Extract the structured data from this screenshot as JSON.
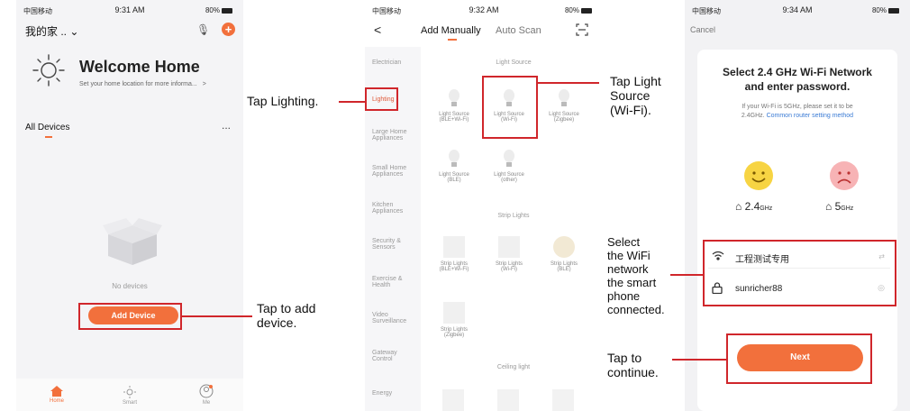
{
  "phone1": {
    "status": {
      "carrier": "中国移动",
      "time": "9:31 AM",
      "battery": "80%"
    },
    "home_name": "我的家",
    "welcome_title": "Welcome Home",
    "welcome_subtitle": "Set your home location for more informa...",
    "welcome_chevron": ">",
    "all_devices_label": "All Devices",
    "more_label": "...",
    "empty_label": "No devices",
    "add_device_label": "Add Device",
    "tabs": [
      {
        "label": "Home",
        "icon": "home-icon"
      },
      {
        "label": "Smart",
        "icon": "smart-icon"
      },
      {
        "label": "Me",
        "icon": "profile-icon"
      }
    ],
    "accent": "#f2703c"
  },
  "phone2": {
    "status": {
      "carrier": "中国移动",
      "time": "9:32 AM",
      "battery": "80%"
    },
    "back_label": "<",
    "tab_manual": "Add Manually",
    "tab_auto": "Auto Scan",
    "categories": [
      "Electrician",
      "Lighting",
      "Large Home Appliances",
      "Small Home Appliances",
      "Kitchen Appliances",
      "Security & Sensors",
      "Exercise & Health",
      "Video Surveillance",
      "Gateway Control",
      "Energy"
    ],
    "section_light": "Light Source",
    "light_items": [
      {
        "name": "Light Source",
        "sub": "(BLE+Wi-Fi)"
      },
      {
        "name": "Light Source",
        "sub": "(Wi-Fi)"
      },
      {
        "name": "Light Source",
        "sub": "(Zigbee)"
      },
      {
        "name": "Light Source",
        "sub": "(BLE)"
      },
      {
        "name": "Light Source",
        "sub": "(other)"
      }
    ],
    "section_strip": "Strip Lights",
    "strip_items": [
      {
        "name": "Strip Lights",
        "sub": "(BLE+Wi-Fi)"
      },
      {
        "name": "Strip Lights",
        "sub": "(Wi-Fi)"
      },
      {
        "name": "Strip Lights",
        "sub": "(BLE)"
      },
      {
        "name": "Strip Lights",
        "sub": "(Zigbee)"
      }
    ],
    "section_ceiling": "Ceiling light"
  },
  "phone3": {
    "status": {
      "carrier": "中国移动",
      "time": "9:34 AM",
      "battery": "80%"
    },
    "cancel_label": "Cancel",
    "title_line1": "Select 2.4 GHz Wi-Fi Network",
    "title_line2": "and enter password.",
    "hint_line1": "If your Wi-Fi is 5GHz, please set it to be",
    "hint_line2_prefix": "2.4GHz.",
    "hint_link": "Common router setting method",
    "band_good": "2.4",
    "band_good_unit": "GHz",
    "band_bad": "5",
    "band_bad_unit": "GHz",
    "wifi_name": "工程测试专用",
    "password": "sunricher88",
    "next_label": "Next"
  },
  "callouts": {
    "tap_lighting": "Tap Lighting.",
    "tap_add_l1": "Tap to add",
    "tap_add_l2": "device.",
    "tap_light_l1": "Tap Light",
    "tap_light_l2": "Source",
    "tap_light_l3": "(Wi-Fi).",
    "select_l1": "Select",
    "select_l2": "the WiFi",
    "select_l3": "network",
    "select_l4": "the smart",
    "select_l5": "phone",
    "select_l6": "connected.",
    "continue_l1": "Tap to",
    "continue_l2": "continue."
  }
}
